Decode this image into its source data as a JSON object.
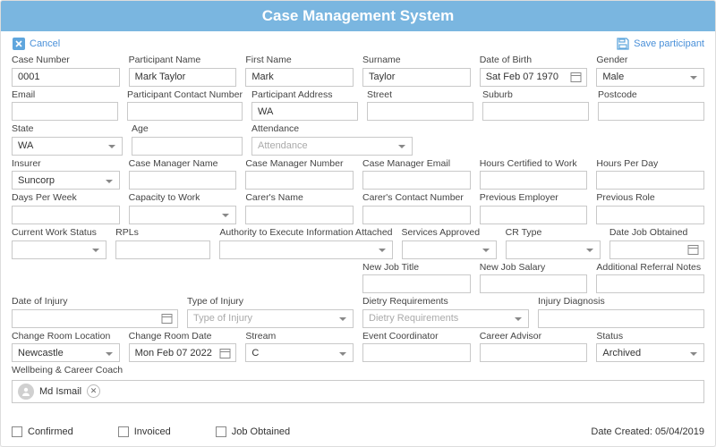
{
  "title": "Case Management System",
  "toolbar": {
    "cancel": "Cancel",
    "save": "Save participant"
  },
  "fields": {
    "case_number": {
      "label": "Case Number",
      "value": "0001"
    },
    "participant_name": {
      "label": "Participant Name",
      "value": "Mark Taylor"
    },
    "first_name": {
      "label": "First Name",
      "value": "Mark"
    },
    "surname": {
      "label": "Surname",
      "value": "Taylor"
    },
    "dob": {
      "label": "Date of Birth",
      "value": "Sat Feb 07 1970"
    },
    "gender": {
      "label": "Gender",
      "value": "Male"
    },
    "email": {
      "label": "Email",
      "value": ""
    },
    "participant_contact": {
      "label": "Participant Contact Number",
      "value": ""
    },
    "participant_address": {
      "label": "Participant Address",
      "value": "WA"
    },
    "street": {
      "label": "Street",
      "value": ""
    },
    "suburb": {
      "label": "Suburb",
      "value": ""
    },
    "postcode": {
      "label": "Postcode",
      "value": ""
    },
    "state": {
      "label": "State",
      "value": "WA"
    },
    "age": {
      "label": "Age",
      "value": ""
    },
    "attendance": {
      "label": "Attendance",
      "value": "",
      "placeholder": "Attendance"
    },
    "insurer": {
      "label": "Insurer",
      "value": "Suncorp"
    },
    "cm_name": {
      "label": "Case Manager Name",
      "value": ""
    },
    "cm_number": {
      "label": "Case Manager Number",
      "value": ""
    },
    "cm_email": {
      "label": "Case Manager Email",
      "value": ""
    },
    "hours_cert": {
      "label": "Hours Certified to Work",
      "value": ""
    },
    "hours_day": {
      "label": "Hours Per Day",
      "value": ""
    },
    "days_week": {
      "label": "Days Per Week",
      "value": ""
    },
    "capacity": {
      "label": "Capacity to Work",
      "value": ""
    },
    "carer_name": {
      "label": "Carer's Name",
      "value": ""
    },
    "carer_contact": {
      "label": "Carer's Contact Number",
      "value": ""
    },
    "prev_employer": {
      "label": "Previous Employer",
      "value": ""
    },
    "prev_role": {
      "label": "Previous Role",
      "value": ""
    },
    "cur_work_status": {
      "label": "Current Work Status",
      "value": ""
    },
    "rpls": {
      "label": "RPLs",
      "value": ""
    },
    "authority": {
      "label": "Authority to Execute Information Attached",
      "value": ""
    },
    "services_approved": {
      "label": "Services Approved",
      "value": ""
    },
    "cr_type": {
      "label": "CR Type",
      "value": ""
    },
    "date_job": {
      "label": "Date Job Obtained",
      "value": ""
    },
    "new_job_title": {
      "label": "New Job Title",
      "value": ""
    },
    "new_job_salary": {
      "label": "New Job Salary",
      "value": ""
    },
    "referral_notes": {
      "label": "Additional Referral Notes",
      "value": ""
    },
    "date_injury": {
      "label": "Date of Injury",
      "value": ""
    },
    "type_injury": {
      "label": "Type of Injury",
      "value": "",
      "placeholder": "Type of Injury"
    },
    "dietry": {
      "label": "Dietry Requirements",
      "value": "",
      "placeholder": "Dietry Requirements"
    },
    "injury_diag": {
      "label": "Injury Diagnosis",
      "value": ""
    },
    "change_room_loc": {
      "label": "Change Room Location",
      "value": "Newcastle"
    },
    "change_room_date": {
      "label": "Change Room Date",
      "value": "Mon Feb 07 2022"
    },
    "stream": {
      "label": "Stream",
      "value": "C"
    },
    "event_coord": {
      "label": "Event Coordinator",
      "value": ""
    },
    "career_advisor": {
      "label": "Career Advisor",
      "value": ""
    },
    "status": {
      "label": "Status",
      "value": "Archived"
    },
    "coach_label": "Wellbeing & Career Coach",
    "coach_value": "Md Ismail"
  },
  "footer": {
    "confirmed": "Confirmed",
    "invoiced": "Invoiced",
    "job_obtained": "Job Obtained",
    "created_label": "Date Created:",
    "created_value": "05/04/2019"
  }
}
